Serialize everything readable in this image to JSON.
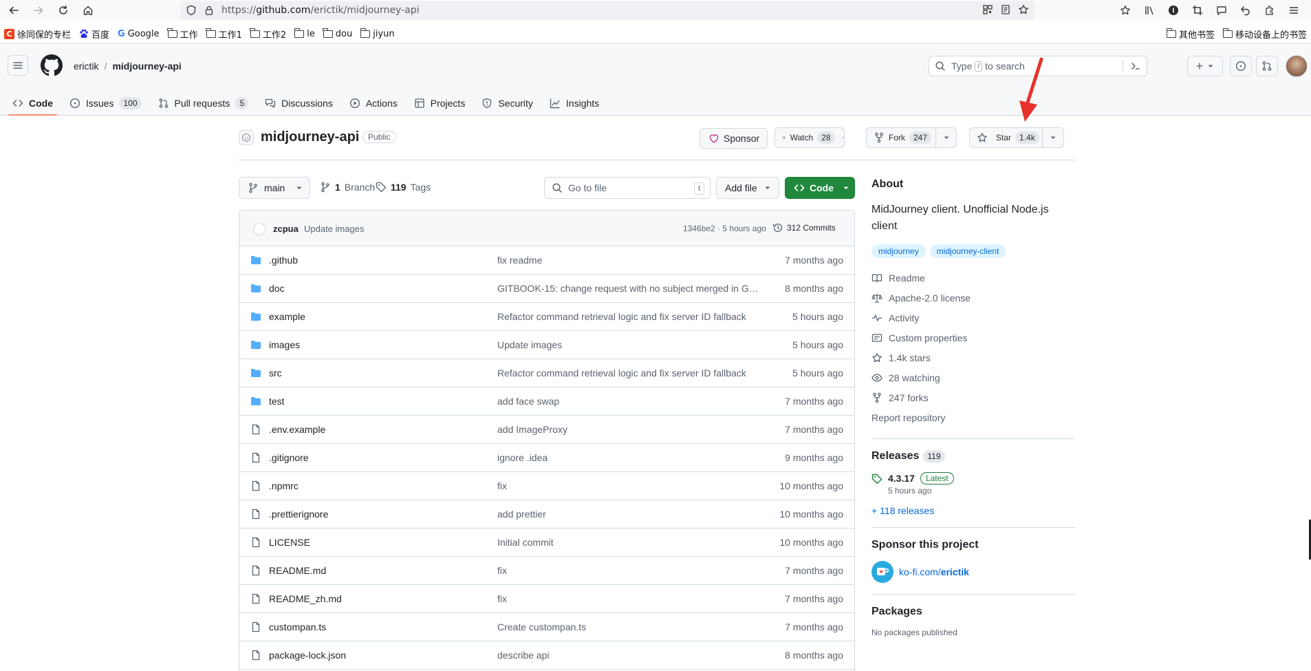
{
  "browser": {
    "url_prefix": "https://",
    "url_domain": "github.com",
    "url_path": "/erictik/midjourney-api",
    "bookmarks": [
      "徐同保的专栏",
      "百度",
      "Google",
      "工作",
      "工作1",
      "工作2",
      "le",
      "dou",
      "jiyun"
    ],
    "bookmarks_right": [
      "其他书签",
      "移动设备上的书签"
    ]
  },
  "header": {
    "owner": "erictik",
    "separator": "/",
    "repo": "midjourney-api",
    "search_placeholder_pre": "Type",
    "search_slash": "/",
    "search_placeholder_post": "to search",
    "plus_label": "+"
  },
  "repo_nav": [
    {
      "label": "Code",
      "icon": "code-icon",
      "counter": ""
    },
    {
      "label": "Issues",
      "icon": "issue-icon",
      "counter": "100"
    },
    {
      "label": "Pull requests",
      "icon": "pull-request-icon",
      "counter": "5"
    },
    {
      "label": "Discussions",
      "icon": "discussion-icon",
      "counter": ""
    },
    {
      "label": "Actions",
      "icon": "play-icon",
      "counter": ""
    },
    {
      "label": "Projects",
      "icon": "table-icon",
      "counter": ""
    },
    {
      "label": "Security",
      "icon": "shield-icon",
      "counter": ""
    },
    {
      "label": "Insights",
      "icon": "graph-icon",
      "counter": ""
    }
  ],
  "repo": {
    "title": "midjourney-api",
    "visibility": "Public",
    "sponsor_label": "Sponsor",
    "watch_label": "Watch",
    "watch_count": "28",
    "fork_label": "Fork",
    "fork_count": "247",
    "star_label": "Star",
    "star_count": "1.4k"
  },
  "code_toolbar": {
    "branch": "main",
    "branch_count": "1",
    "branch_label": "Branch",
    "tag_count": "119",
    "tag_label": "Tags",
    "goto_placeholder": "Go to file",
    "goto_key": "t",
    "add_file": "Add file",
    "code_label": "Code"
  },
  "latest_commit": {
    "author": "zcpua",
    "message": "Update images",
    "hash": "1346be2",
    "dot": "·",
    "age": "5 hours ago",
    "commits": "312 Commits"
  },
  "files": [
    {
      "name": ".github",
      "type": "dir",
      "commit": "fix readme",
      "age": "7 months ago"
    },
    {
      "name": "doc",
      "type": "dir",
      "commit": "GITBOOK-15: change request with no subject merged in Git…",
      "age": "8 months ago"
    },
    {
      "name": "example",
      "type": "dir",
      "commit": "Refactor command retrieval logic and fix server ID fallback",
      "age": "5 hours ago"
    },
    {
      "name": "images",
      "type": "dir",
      "commit": "Update images",
      "age": "5 hours ago"
    },
    {
      "name": "src",
      "type": "dir",
      "commit": "Refactor command retrieval logic and fix server ID fallback",
      "age": "5 hours ago"
    },
    {
      "name": "test",
      "type": "dir",
      "commit": "add face swap",
      "age": "7 months ago"
    },
    {
      "name": ".env.example",
      "type": "file",
      "commit": "add ImageProxy",
      "age": "7 months ago"
    },
    {
      "name": ".gitignore",
      "type": "file",
      "commit": "ignore .idea",
      "age": "9 months ago"
    },
    {
      "name": ".npmrc",
      "type": "file",
      "commit": "fix",
      "age": "10 months ago"
    },
    {
      "name": ".prettierignore",
      "type": "file",
      "commit": "add prettier",
      "age": "10 months ago"
    },
    {
      "name": "LICENSE",
      "type": "file",
      "commit": "Initial commit",
      "age": "10 months ago"
    },
    {
      "name": "README.md",
      "type": "file",
      "commit": "fix",
      "age": "7 months ago"
    },
    {
      "name": "README_zh.md",
      "type": "file",
      "commit": "fix",
      "age": "7 months ago"
    },
    {
      "name": "custompan.ts",
      "type": "file",
      "commit": "Create custompan.ts",
      "age": "7 months ago"
    },
    {
      "name": "package-lock.json",
      "type": "file",
      "commit": "describe api",
      "age": "8 months ago"
    }
  ],
  "about": {
    "title": "About",
    "description": "MidJourney client. Unofficial Node.js client",
    "topics": [
      "midjourney",
      "midjourney-client"
    ],
    "items": [
      {
        "label": "Readme",
        "icon": "book-icon"
      },
      {
        "label": "Apache-2.0 license",
        "icon": "law-icon"
      },
      {
        "label": "Activity",
        "icon": "pulse-icon"
      },
      {
        "label": "Custom properties",
        "icon": "note-icon"
      },
      {
        "label": "1.4k stars",
        "icon": "star-icon"
      },
      {
        "label": "28 watching",
        "icon": "eye-icon"
      },
      {
        "label": "247 forks",
        "icon": "fork-icon"
      }
    ],
    "report": "Report repository"
  },
  "releases": {
    "title": "Releases",
    "count": "119",
    "latest_tag": "4.3.17",
    "latest_badge": "Latest",
    "latest_age": "5 hours ago",
    "more": "+ 118 releases"
  },
  "sponsor": {
    "title": "Sponsor this project",
    "link_prefix": "ko-fi.com/",
    "link_user": "erictik"
  },
  "packages": {
    "title": "Packages",
    "note": "No packages published"
  },
  "colors": {
    "accent_orange": "#fd8c73",
    "link_blue": "#0969da",
    "code_green": "#1f883d",
    "annotation_red": "#e8312b"
  }
}
